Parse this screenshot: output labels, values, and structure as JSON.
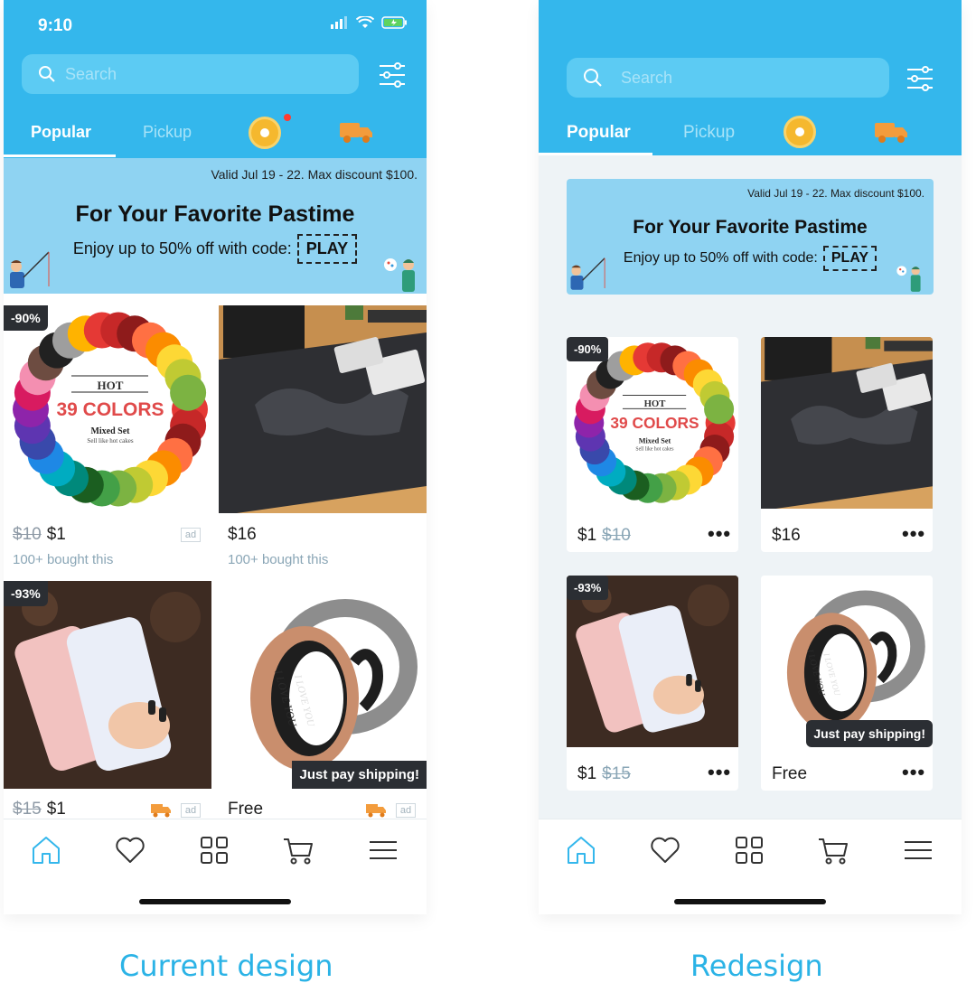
{
  "current": {
    "caption": "Current design",
    "status_time": "9:10",
    "search_placeholder": "Search",
    "tabs": [
      "Popular",
      "Pickup"
    ],
    "banner": {
      "valid": "Valid Jul 19 - 22. Max discount $100.",
      "title": "For Your Favorite Pastime",
      "subtitle": "Enjoy up to 50% off with code:",
      "code": "PLAY"
    },
    "products": [
      {
        "discount": "-90%",
        "old_price": "$10",
        "price": "$1",
        "bought": "100+ bought this",
        "ad": "ad",
        "img_text": [
          "HOT",
          "39 COLORS",
          "Mixed Set",
          "Sell like hot cakes"
        ]
      },
      {
        "price": "$16",
        "bought": "100+ bought this"
      },
      {
        "discount": "-93%",
        "old_price": "$15",
        "price": "$1",
        "ad": "ad"
      },
      {
        "badge": "Just pay shipping!",
        "price": "Free",
        "ad": "ad",
        "ring_text": [
          "I LOVE YOU",
          "I LOVE YOU"
        ]
      }
    ]
  },
  "redesign": {
    "caption": "Redesign",
    "search_placeholder": "Search",
    "tabs": [
      "Popular",
      "Pickup"
    ],
    "banner": {
      "valid": "Valid Jul 19 - 22. Max discount $100.",
      "title": "For Your Favorite Pastime",
      "subtitle": "Enjoy up to 50% off with code:",
      "code": "PLAY"
    },
    "products": [
      {
        "discount": "-90%",
        "price": "$1",
        "old_price": "$10",
        "more": "•••",
        "img_text": [
          "HOT",
          "39 COLORS",
          "Mixed Set",
          "Sell like hot cakes"
        ]
      },
      {
        "price": "$16",
        "more": "•••"
      },
      {
        "discount": "-93%",
        "price": "$1",
        "old_price": "$15",
        "more": "•••"
      },
      {
        "badge": "Just pay shipping!",
        "price": "Free",
        "more": "•••",
        "ring_text": [
          "I LOVE YOU",
          "I LOVE YOU"
        ]
      }
    ]
  },
  "colors": {
    "accent": "#34b7ec",
    "banner": "#8fd3f2",
    "badge": "#2b2e33",
    "caption": "#2bb3e6",
    "truck": "#f39c3c"
  }
}
